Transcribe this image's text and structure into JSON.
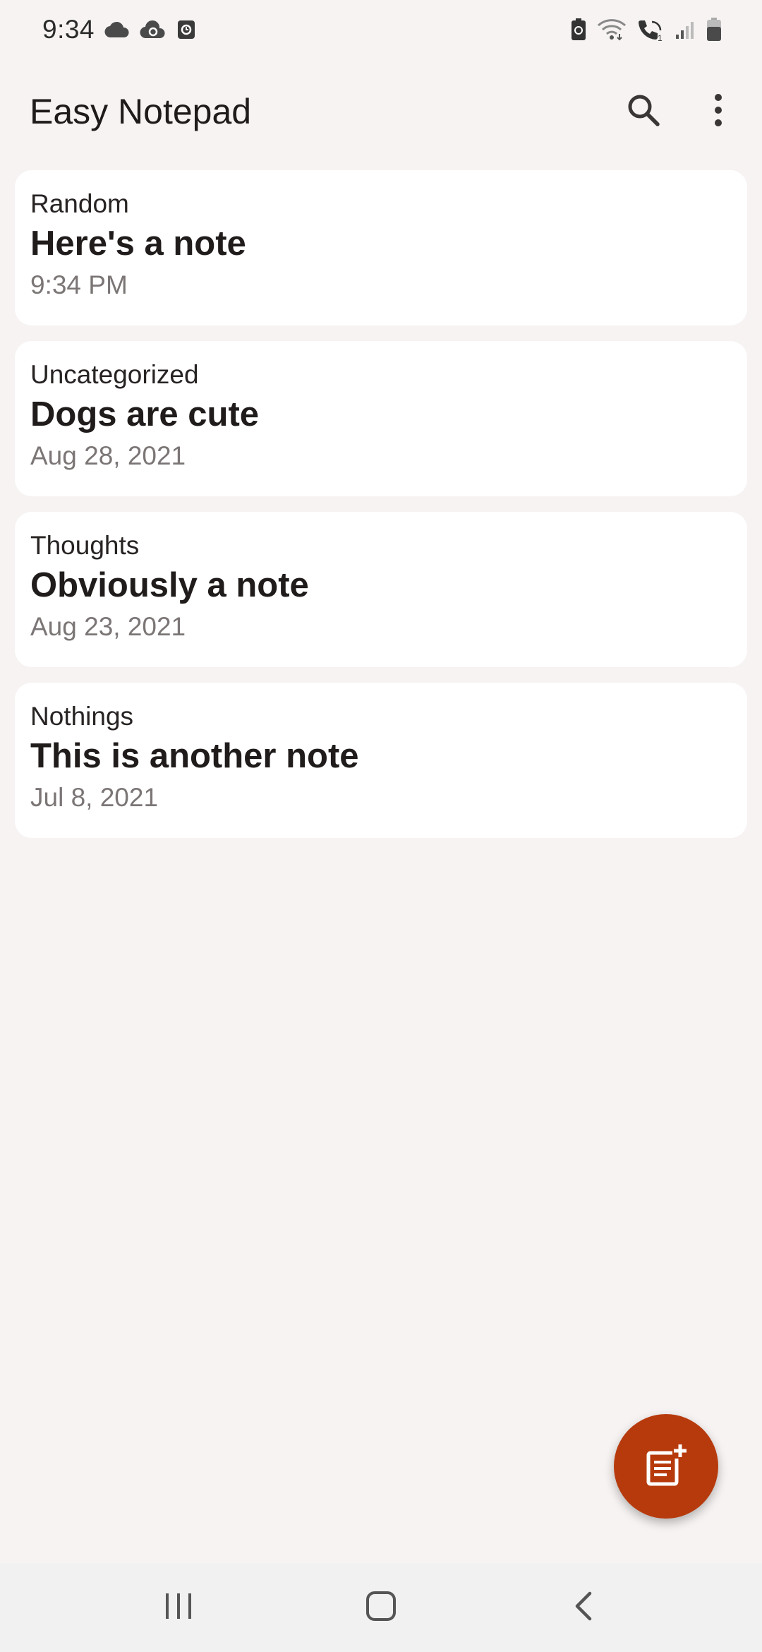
{
  "status_bar": {
    "time": "9:34",
    "left_icons": [
      "cloud-icon",
      "sync-cloud-icon",
      "clock-app-icon"
    ],
    "right_icons": [
      "battery-saver-icon",
      "wifi-icon",
      "wifi-calling-icon",
      "signal-icon",
      "battery-icon"
    ]
  },
  "app_bar": {
    "title": "Easy Notepad",
    "actions": [
      "search-icon",
      "more-vert-icon"
    ]
  },
  "notes": [
    {
      "category": "Random",
      "title": "Here's a note",
      "date": "9:34 PM"
    },
    {
      "category": "Uncategorized",
      "title": "Dogs are cute",
      "date": "Aug 28, 2021"
    },
    {
      "category": "Thoughts",
      "title": "Obviously a note",
      "date": "Aug 23, 2021"
    },
    {
      "category": "Nothings",
      "title": "This is another note",
      "date": "Jul 8, 2021"
    }
  ],
  "fab": {
    "icon": "new-note-icon"
  },
  "nav_bar": {
    "buttons": [
      "recents-icon",
      "home-icon",
      "back-icon"
    ]
  },
  "colors": {
    "background": "#f6f3f2",
    "card": "#ffffff",
    "accent": "#b73a0c",
    "secondary_text": "#7b7675"
  }
}
